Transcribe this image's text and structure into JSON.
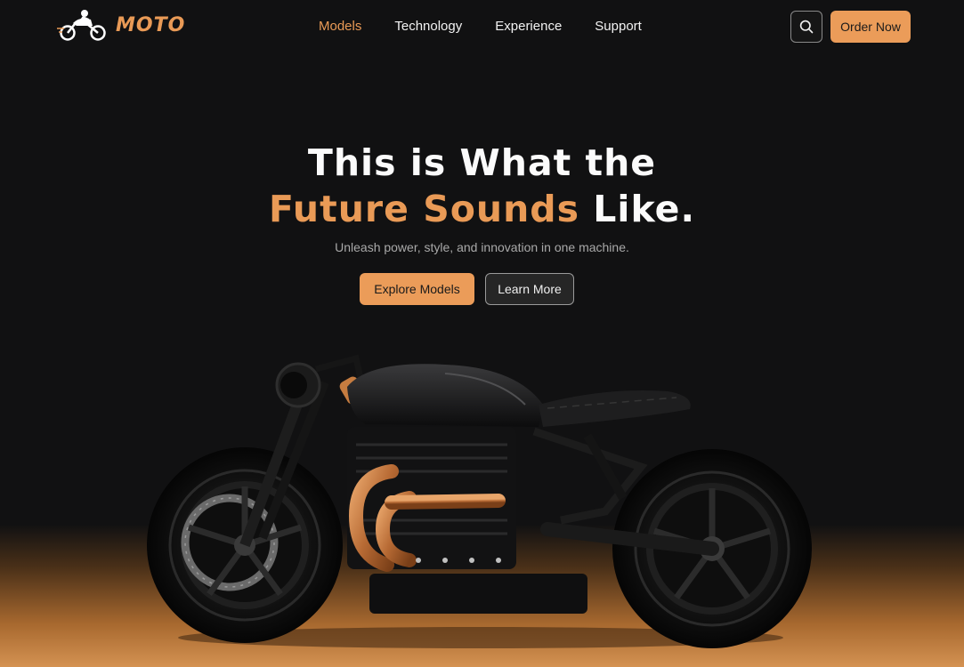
{
  "brand": {
    "name": "MOTO",
    "accent_color": "#e99a56"
  },
  "nav": {
    "items": [
      {
        "label": "Models",
        "active": true
      },
      {
        "label": "Technology",
        "active": false
      },
      {
        "label": "Experience",
        "active": false
      },
      {
        "label": "Support",
        "active": false
      }
    ],
    "search_icon": "search-icon",
    "order_label": "Order Now"
  },
  "hero": {
    "title_line1": "This is What the",
    "title_line2_accent": "Future Sounds",
    "title_line2_rest": " Like.",
    "subtitle": "Unleash power, style, and innovation in one machine.",
    "primary_cta": "Explore Models",
    "secondary_cta": "Learn More"
  },
  "image": {
    "subject": "black-cafe-racer-motorcycle",
    "accent": "copper-exhaust"
  }
}
